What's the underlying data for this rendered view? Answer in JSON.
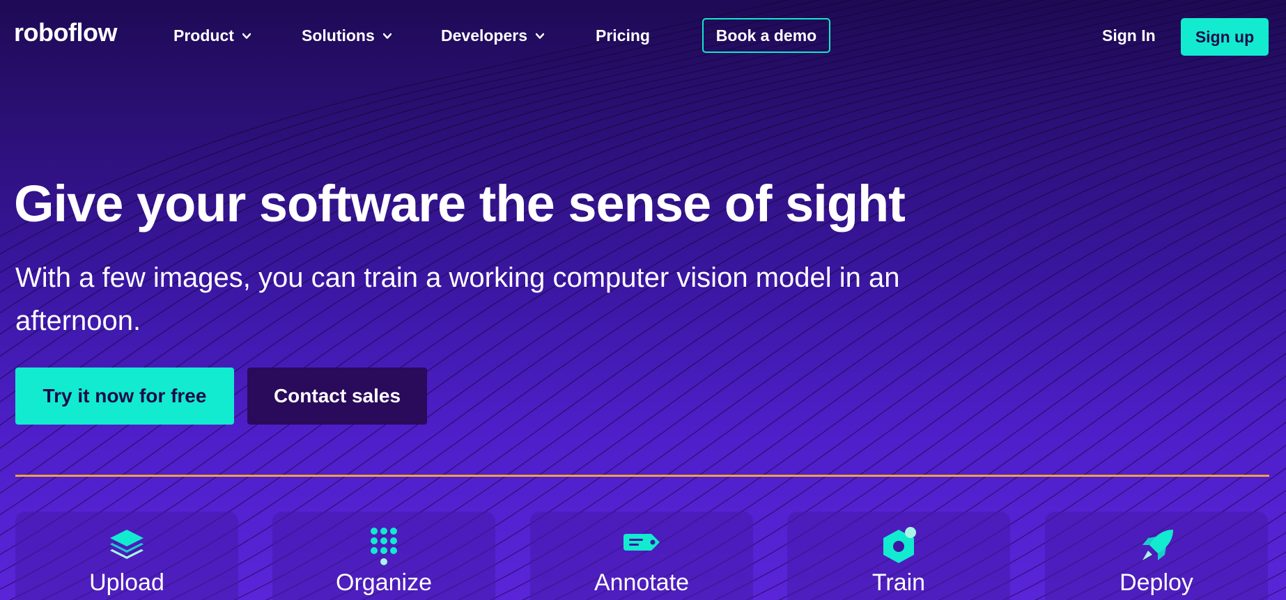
{
  "brand": {
    "logo": "roboflow",
    "accent": "#12ebcf",
    "divider_color": "#f0a23c"
  },
  "nav": {
    "items": [
      {
        "label": "Product",
        "dropdown": true
      },
      {
        "label": "Solutions",
        "dropdown": true
      },
      {
        "label": "Developers",
        "dropdown": true
      },
      {
        "label": "Pricing",
        "dropdown": false
      }
    ],
    "book_demo": "Book a demo",
    "sign_in": "Sign In",
    "sign_up": "Sign up"
  },
  "hero": {
    "title": "Give your software the sense of sight",
    "subtitle": "With a few images, you can train a working computer vision model in an afternoon.",
    "cta_primary": "Try it now for free",
    "cta_secondary": "Contact sales"
  },
  "features": [
    {
      "label": "Upload",
      "icon": "layers-icon"
    },
    {
      "label": "Organize",
      "icon": "dots-grid-icon"
    },
    {
      "label": "Annotate",
      "icon": "tag-icon"
    },
    {
      "label": "Train",
      "icon": "hexagon-icon"
    },
    {
      "label": "Deploy",
      "icon": "rocket-icon"
    }
  ]
}
